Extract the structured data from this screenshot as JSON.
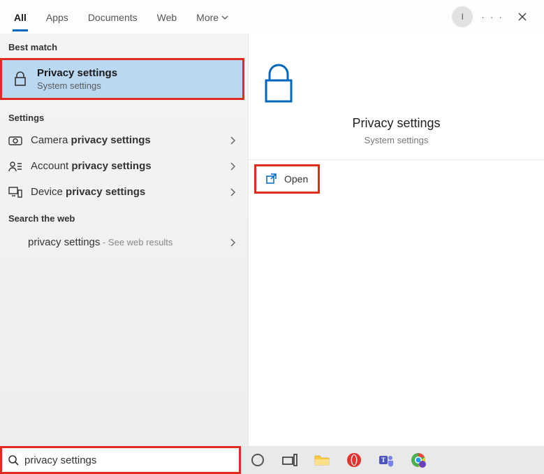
{
  "tabs": {
    "items": [
      "All",
      "Apps",
      "Documents",
      "Web",
      "More"
    ],
    "active_index": 0
  },
  "avatar_initial": "I",
  "left": {
    "best_match_header": "Best match",
    "best_match": {
      "title": "Privacy settings",
      "subtitle": "System settings"
    },
    "settings_header": "Settings",
    "settings_items": [
      {
        "prefix": "Camera ",
        "bold": "privacy settings"
      },
      {
        "prefix": "Account ",
        "bold": "privacy settings"
      },
      {
        "prefix": "Device ",
        "bold": "privacy settings"
      }
    ],
    "web_header": "Search the web",
    "web_item": {
      "label": "privacy settings",
      "suffix": " - See web results"
    }
  },
  "preview": {
    "title": "Privacy settings",
    "subtitle": "System settings",
    "open_label": "Open"
  },
  "search": {
    "value": "privacy settings"
  },
  "taskbar_icons": [
    "cortana",
    "task-view",
    "file-explorer",
    "opera",
    "teams",
    "chrome"
  ]
}
